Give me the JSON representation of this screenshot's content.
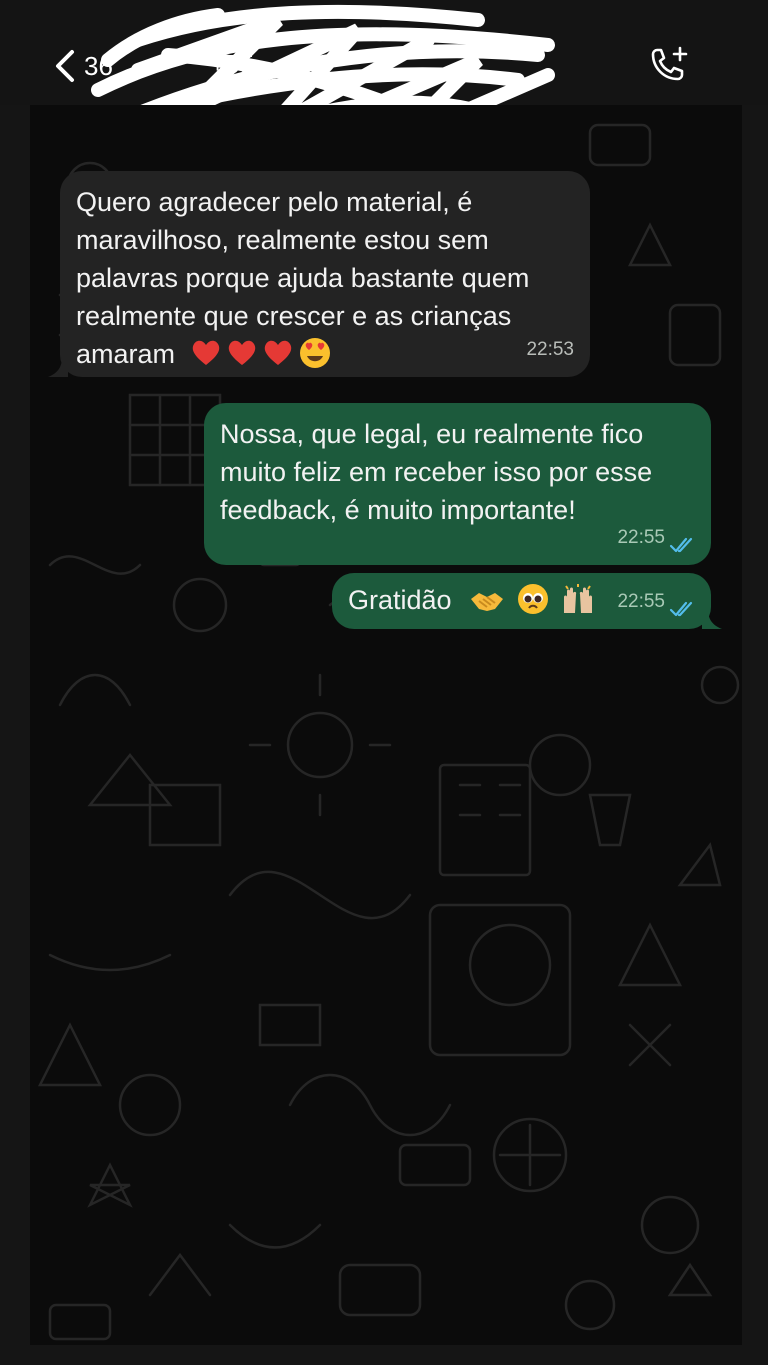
{
  "header": {
    "back_count": "36",
    "contact_name": "+55 ...",
    "icons": {
      "back": "chevron-left-icon",
      "call": "add-call-icon"
    }
  },
  "messages": [
    {
      "direction": "incoming",
      "text": "Quero agradecer pelo material, é\nmaravilhoso, realmente estou sem\npalavras porque ajuda bastante quem\nrealmente que crescer e as crianças\namaram",
      "emojis": [
        "red-heart",
        "red-heart",
        "red-heart",
        "heart-eyes"
      ],
      "time": "22:53"
    },
    {
      "direction": "outgoing",
      "text": "Nossa, que legal, eu realmente fico\nmuito feliz em receber isso por esse\nfeedback, é muito importante!",
      "time": "22:55",
      "status": "read"
    },
    {
      "direction": "outgoing",
      "text": "Gratidão",
      "emojis": [
        "handshake",
        "pleading-face",
        "raising-hands"
      ],
      "time": "22:55",
      "status": "read"
    }
  ],
  "colors": {
    "incoming_bubble": "#232323",
    "outgoing_bubble": "#1c5a3c",
    "read_ticks": "#53bdeb",
    "background": "#0b0b0b"
  }
}
